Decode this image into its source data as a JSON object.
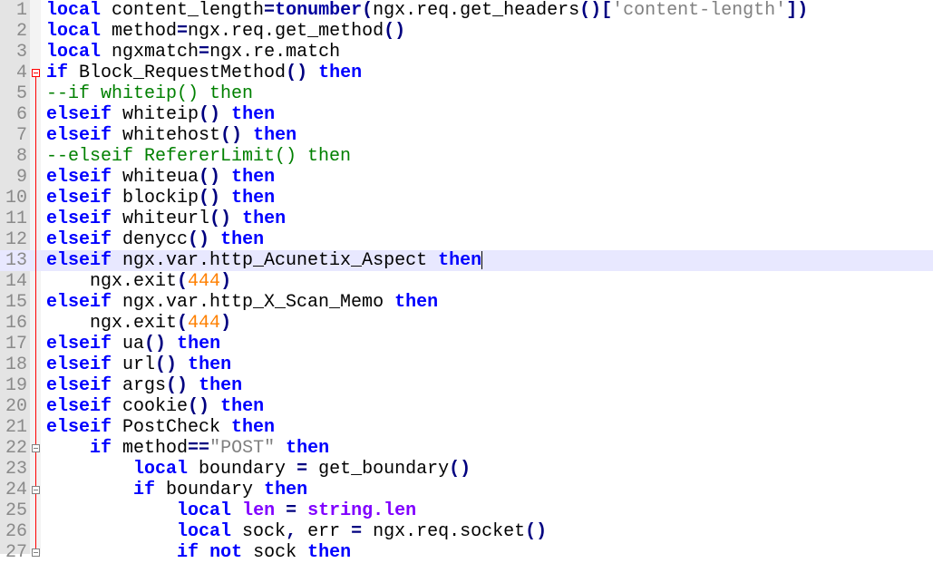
{
  "editor": {
    "current_line": 13,
    "colors": {
      "keyword": "#0000ff",
      "comment": "#008000",
      "number": "#ff8000",
      "string": "#808080",
      "library": "#8000ff",
      "current_line_bg": "#e8e8ff",
      "fold_marker": "#ff0000"
    },
    "fold_markers": [
      {
        "line": 4,
        "icon": "fold-minus-icon"
      },
      {
        "line": 22,
        "icon": "fold-minus-icon"
      },
      {
        "line": 24,
        "icon": "fold-minus-icon"
      },
      {
        "line": 27,
        "icon": "fold-minus-icon"
      }
    ],
    "lines": [
      {
        "n": "1",
        "tokens": [
          [
            "kw",
            "local"
          ],
          [
            "id",
            " content_length"
          ],
          [
            "op",
            "="
          ],
          [
            "fn",
            "tonumber"
          ],
          [
            "op",
            "("
          ],
          [
            "id",
            "ngx.req.get_headers"
          ],
          [
            "op",
            "()["
          ],
          [
            "str",
            "'content-length'"
          ],
          [
            "op",
            "])"
          ]
        ]
      },
      {
        "n": "2",
        "tokens": [
          [
            "kw",
            "local"
          ],
          [
            "id",
            " method"
          ],
          [
            "op",
            "="
          ],
          [
            "id",
            "ngx.req.get_method"
          ],
          [
            "op",
            "()"
          ]
        ]
      },
      {
        "n": "3",
        "tokens": [
          [
            "kw",
            "local"
          ],
          [
            "id",
            " ngxmatch"
          ],
          [
            "op",
            "="
          ],
          [
            "id",
            "ngx.re.match"
          ]
        ]
      },
      {
        "n": "4",
        "tokens": [
          [
            "kw",
            "if"
          ],
          [
            "id",
            " Block_RequestMethod"
          ],
          [
            "op",
            "()"
          ],
          [
            "id",
            " "
          ],
          [
            "kw",
            "then"
          ]
        ]
      },
      {
        "n": "5",
        "tokens": [
          [
            "cm",
            "--if whiteip() then"
          ]
        ]
      },
      {
        "n": "6",
        "tokens": [
          [
            "kw",
            "elseif"
          ],
          [
            "id",
            " whiteip"
          ],
          [
            "op",
            "()"
          ],
          [
            "id",
            " "
          ],
          [
            "kw",
            "then"
          ]
        ]
      },
      {
        "n": "7",
        "tokens": [
          [
            "kw",
            "elseif"
          ],
          [
            "id",
            " whitehost"
          ],
          [
            "op",
            "()"
          ],
          [
            "id",
            " "
          ],
          [
            "kw",
            "then"
          ]
        ]
      },
      {
        "n": "8",
        "tokens": [
          [
            "cm",
            "--elseif RefererLimit() then"
          ]
        ]
      },
      {
        "n": "9",
        "tokens": [
          [
            "kw",
            "elseif"
          ],
          [
            "id",
            " whiteua"
          ],
          [
            "op",
            "()"
          ],
          [
            "id",
            " "
          ],
          [
            "kw",
            "then"
          ]
        ]
      },
      {
        "n": "10",
        "tokens": [
          [
            "kw",
            "elseif"
          ],
          [
            "id",
            " blockip"
          ],
          [
            "op",
            "()"
          ],
          [
            "id",
            " "
          ],
          [
            "kw",
            "then"
          ]
        ]
      },
      {
        "n": "11",
        "tokens": [
          [
            "kw",
            "elseif"
          ],
          [
            "id",
            " whiteurl"
          ],
          [
            "op",
            "()"
          ],
          [
            "id",
            " "
          ],
          [
            "kw",
            "then"
          ]
        ]
      },
      {
        "n": "12",
        "tokens": [
          [
            "kw",
            "elseif"
          ],
          [
            "id",
            " denycc"
          ],
          [
            "op",
            "()"
          ],
          [
            "id",
            " "
          ],
          [
            "kw",
            "then"
          ]
        ]
      },
      {
        "n": "13",
        "tokens": [
          [
            "kw",
            "elseif"
          ],
          [
            "id",
            " ngx.var.http_Acunetix_Aspect "
          ],
          [
            "kw",
            "then"
          ]
        ]
      },
      {
        "n": "14",
        "tokens": [
          [
            "id",
            "    ngx.exit"
          ],
          [
            "op",
            "("
          ],
          [
            "num",
            "444"
          ],
          [
            "op",
            ")"
          ]
        ]
      },
      {
        "n": "15",
        "tokens": [
          [
            "kw",
            "elseif"
          ],
          [
            "id",
            " ngx.var.http_X_Scan_Memo "
          ],
          [
            "kw",
            "then"
          ]
        ]
      },
      {
        "n": "16",
        "tokens": [
          [
            "id",
            "    ngx.exit"
          ],
          [
            "op",
            "("
          ],
          [
            "num",
            "444"
          ],
          [
            "op",
            ")"
          ]
        ]
      },
      {
        "n": "17",
        "tokens": [
          [
            "kw",
            "elseif"
          ],
          [
            "id",
            " ua"
          ],
          [
            "op",
            "()"
          ],
          [
            "id",
            " "
          ],
          [
            "kw",
            "then"
          ]
        ]
      },
      {
        "n": "18",
        "tokens": [
          [
            "kw",
            "elseif"
          ],
          [
            "id",
            " url"
          ],
          [
            "op",
            "()"
          ],
          [
            "id",
            " "
          ],
          [
            "kw",
            "then"
          ]
        ]
      },
      {
        "n": "19",
        "tokens": [
          [
            "kw",
            "elseif"
          ],
          [
            "id",
            " args"
          ],
          [
            "op",
            "()"
          ],
          [
            "id",
            " "
          ],
          [
            "kw",
            "then"
          ]
        ]
      },
      {
        "n": "20",
        "tokens": [
          [
            "kw",
            "elseif"
          ],
          [
            "id",
            " cookie"
          ],
          [
            "op",
            "()"
          ],
          [
            "id",
            " "
          ],
          [
            "kw",
            "then"
          ]
        ]
      },
      {
        "n": "21",
        "tokens": [
          [
            "kw",
            "elseif"
          ],
          [
            "id",
            " PostCheck "
          ],
          [
            "kw",
            "then"
          ]
        ]
      },
      {
        "n": "22",
        "tokens": [
          [
            "id",
            "    "
          ],
          [
            "kw",
            "if"
          ],
          [
            "id",
            " method"
          ],
          [
            "op",
            "=="
          ],
          [
            "str",
            "\"POST\""
          ],
          [
            "id",
            " "
          ],
          [
            "kw",
            "then"
          ]
        ]
      },
      {
        "n": "23",
        "tokens": [
          [
            "id",
            "        "
          ],
          [
            "kw",
            "local"
          ],
          [
            "id",
            " boundary "
          ],
          [
            "op",
            "="
          ],
          [
            "id",
            " get_boundary"
          ],
          [
            "op",
            "()"
          ]
        ]
      },
      {
        "n": "24",
        "tokens": [
          [
            "id",
            "        "
          ],
          [
            "kw",
            "if"
          ],
          [
            "id",
            " boundary "
          ],
          [
            "kw",
            "then"
          ]
        ]
      },
      {
        "n": "25",
        "tokens": [
          [
            "id",
            "            "
          ],
          [
            "kw",
            "local"
          ],
          [
            "id",
            " "
          ],
          [
            "lib",
            "len"
          ],
          [
            "id",
            " "
          ],
          [
            "op",
            "="
          ],
          [
            "id",
            " "
          ],
          [
            "lib",
            "string.len"
          ]
        ]
      },
      {
        "n": "26",
        "tokens": [
          [
            "id",
            "            "
          ],
          [
            "kw",
            "local"
          ],
          [
            "id",
            " sock"
          ],
          [
            "op",
            ","
          ],
          [
            "id",
            " err "
          ],
          [
            "op",
            "="
          ],
          [
            "id",
            " ngx.req.socket"
          ],
          [
            "op",
            "()"
          ]
        ]
      },
      {
        "n": "27",
        "tokens": [
          [
            "id",
            "            "
          ],
          [
            "kw",
            "if"
          ],
          [
            "id",
            " "
          ],
          [
            "kw",
            "not"
          ],
          [
            "id",
            " sock "
          ],
          [
            "kw",
            "then"
          ]
        ]
      }
    ]
  }
}
